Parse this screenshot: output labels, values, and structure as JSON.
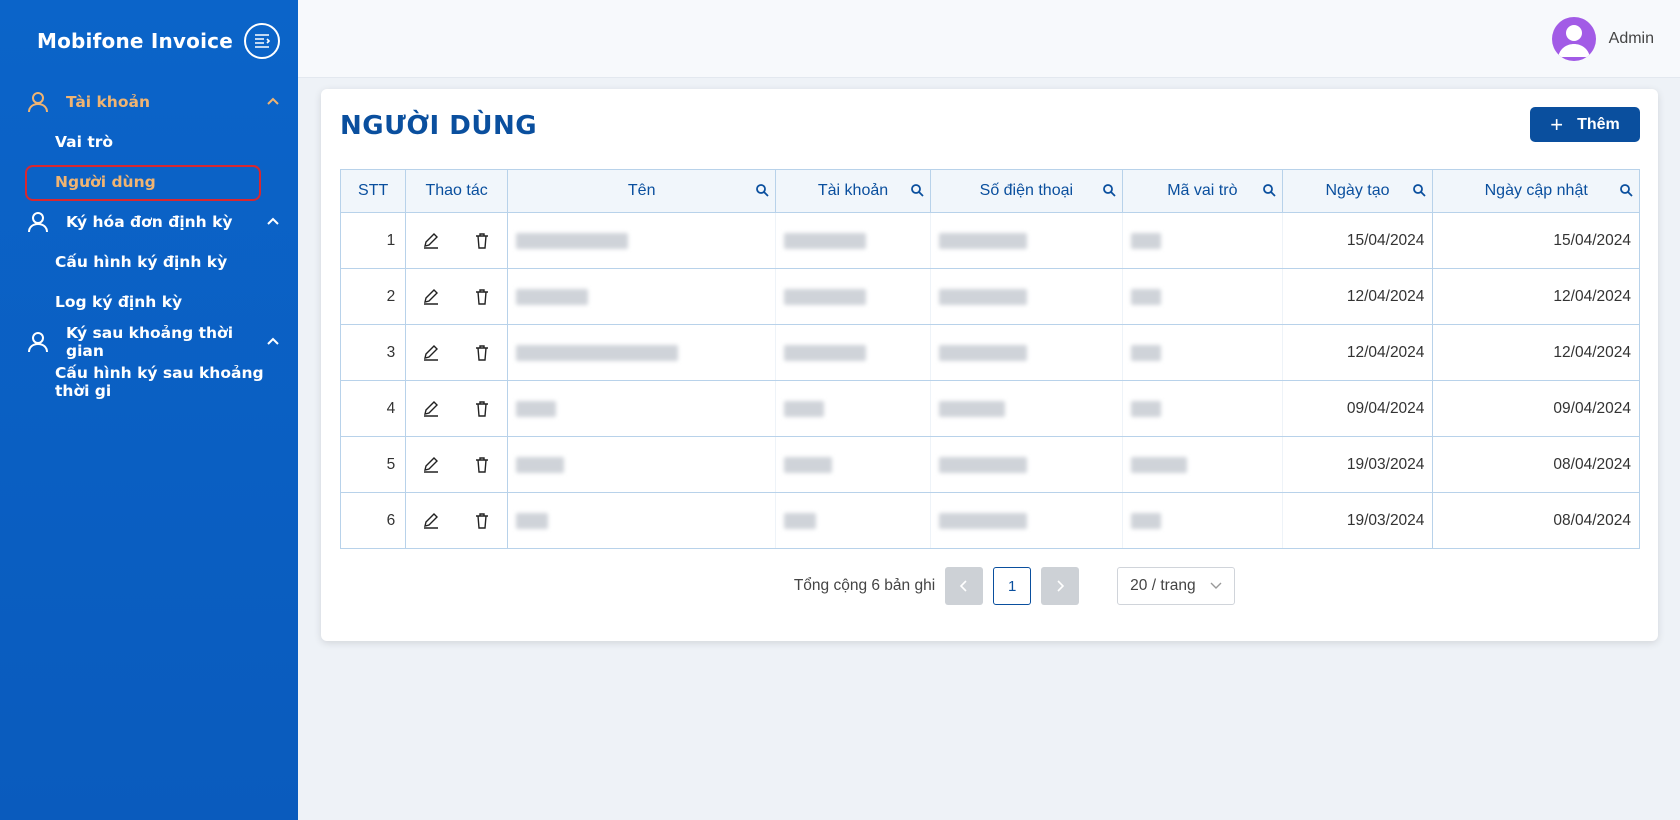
{
  "app": {
    "brand": "Mobifone Invoice"
  },
  "sidebar": {
    "groups": [
      {
        "label": "Tài khoản",
        "items": [
          "Vai trò",
          "Người dùng"
        ]
      },
      {
        "label": "Ký hóa đơn định kỳ",
        "items": [
          "Cấu hình ký định kỳ",
          "Log ký định kỳ"
        ]
      },
      {
        "label": "Ký sau khoảng thời gian",
        "items": [
          "Cấu hình ký sau khoảng thời gi"
        ]
      }
    ],
    "active_item": "Người dùng"
  },
  "header": {
    "user_name": "Admin"
  },
  "page": {
    "title": "NGƯỜI DÙNG",
    "add_label": "Thêm"
  },
  "table": {
    "columns": [
      "STT",
      "Thao tác",
      "Tên",
      "Tài khoản",
      "Số điện thoại",
      "Mã vai trò",
      "Ngày tạo",
      "Ngày cập nhật"
    ],
    "rows": [
      {
        "stt": "1",
        "created": "15/04/2024",
        "updated": "15/04/2024"
      },
      {
        "stt": "2",
        "created": "12/04/2024",
        "updated": "12/04/2024"
      },
      {
        "stt": "3",
        "created": "12/04/2024",
        "updated": "12/04/2024"
      },
      {
        "stt": "4",
        "created": "09/04/2024",
        "updated": "09/04/2024"
      },
      {
        "stt": "5",
        "created": "19/03/2024",
        "updated": "08/04/2024"
      },
      {
        "stt": "6",
        "created": "19/03/2024",
        "updated": "08/04/2024"
      }
    ]
  },
  "pagination": {
    "total_text": "Tổng cộng 6 bản ghi",
    "current_page": "1",
    "page_size": "20 / trang"
  },
  "colors": {
    "sidebar": "#0b64c9",
    "accent": "#0a4f9e",
    "active": "#f0b472",
    "highlight": "#d9272f"
  }
}
